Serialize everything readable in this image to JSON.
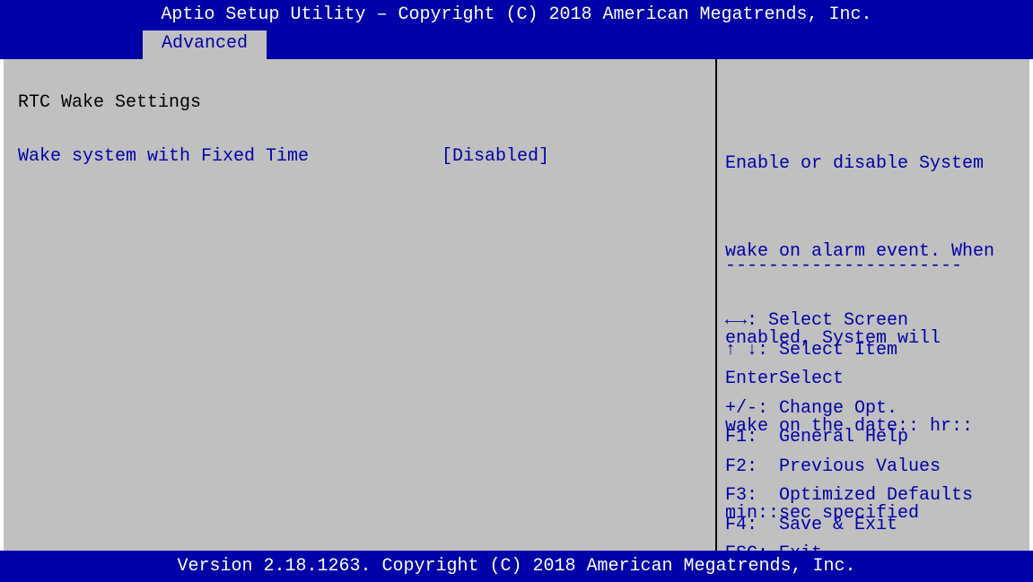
{
  "header": {
    "title": "Aptio Setup Utility – Copyright (C) 2018 American Megatrends, Inc."
  },
  "tabs": [
    {
      "label": "Advanced",
      "active": true
    }
  ],
  "main": {
    "heading": "RTC Wake Settings",
    "settings": [
      {
        "label": "Wake system with Fixed Time",
        "value": "[Disabled]"
      }
    ]
  },
  "help": {
    "description": [
      "Enable or disable System",
      "wake on alarm event. When",
      "enabled, System will",
      "wake on the date:: hr::",
      "min::sec specified"
    ],
    "separator": "----------------------",
    "keys": [
      "←→: Select Screen",
      "↑ ↓: Select Item",
      "EnterSelect",
      "+/-: Change Opt.",
      "F1:  General Help",
      "F2:  Previous Values",
      "F3:  Optimized Defaults",
      "F4:  Save & Exit",
      "ESC: Exit"
    ]
  },
  "footer": {
    "version": "Version 2.18.1263. Copyright (C) 2018 American Megatrends, Inc."
  },
  "colors": {
    "bar_blue": "#0000a8",
    "panel_gray": "#c0c0c0",
    "text_white": "#ffffff",
    "text_black": "#000000"
  }
}
